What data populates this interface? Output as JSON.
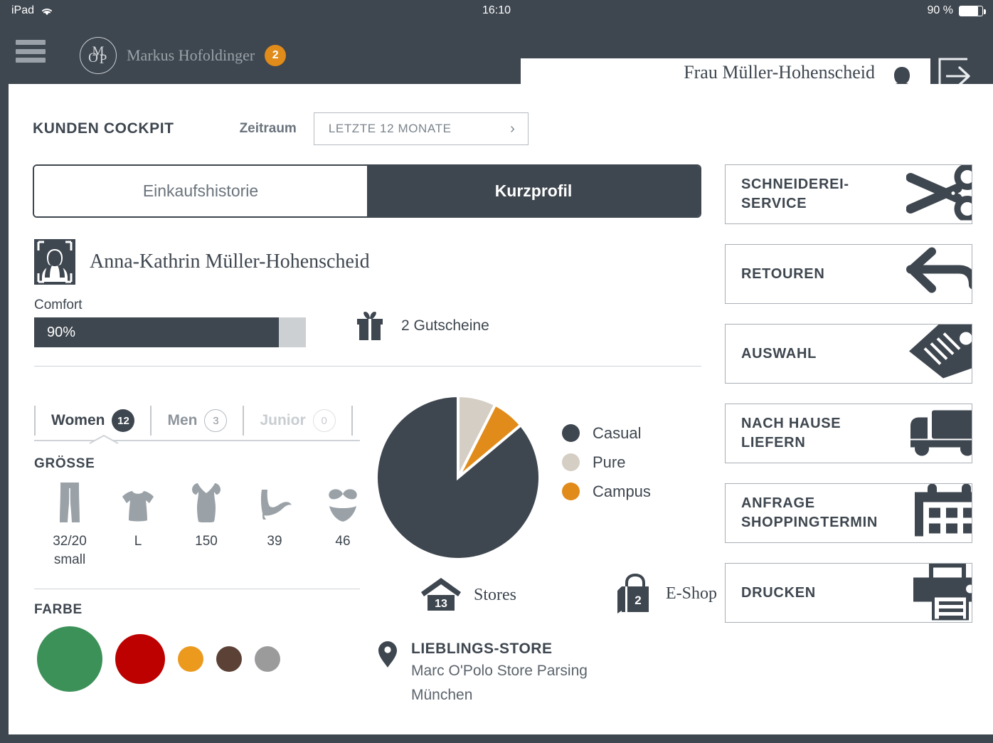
{
  "statusbar": {
    "device": "iPad",
    "wifi_icon": "wifi-icon",
    "time": "16:10",
    "battery_text": "90 %",
    "battery_level": 80
  },
  "header": {
    "menu_icon": "hamburger-menu-icon",
    "logo_icon": "marc-o-polo-logo-icon",
    "user_name": "Markus Hofoldinger",
    "notification_count": "2",
    "customer_name": "Frau Müller-Hohenscheid",
    "customer_status": "Comfort • 90%",
    "customer_avatar_icon": "female-avatar-check-icon",
    "logout_icon": "logout-arrow-icon"
  },
  "page": {
    "title": "KUNDEN COCKPIT",
    "period_label": "Zeitraum",
    "period_value": "LETZTE 12 MONATE",
    "period_chevron": "chevron-right-icon"
  },
  "tabs": [
    {
      "label": "Einkaufshistorie",
      "active": false
    },
    {
      "label": "Kurzprofil",
      "active": true
    }
  ],
  "profile": {
    "avatar_icon": "customer-portrait-icon",
    "name": "Anna-Kathrin Müller-Hohenscheid",
    "comfort_label": "Comfort",
    "comfort_value": "90%",
    "comfort_percent": 90,
    "voucher_icon": "gift-icon",
    "voucher_text": "2 Gutscheine"
  },
  "segments": [
    {
      "label": "Women",
      "count": "12",
      "state": "active"
    },
    {
      "label": "Men",
      "count": "3",
      "state": "mid"
    },
    {
      "label": "Junior",
      "count": "0",
      "state": "dim"
    }
  ],
  "sizes": {
    "title": "GRÖSSE",
    "items": [
      {
        "icon": "pants-icon",
        "value": "32/20\nsmall"
      },
      {
        "icon": "tshirt-icon",
        "value": "L"
      },
      {
        "icon": "dress-icon",
        "value": "150"
      },
      {
        "icon": "high-heel-shoe-icon",
        "value": "39"
      },
      {
        "icon": "bikini-icon",
        "value": "46"
      }
    ]
  },
  "colors": {
    "title": "FARBE",
    "items": [
      {
        "name": "green",
        "hex": "#3c9158",
        "size": 92
      },
      {
        "name": "dark-red",
        "hex": "#bd0000",
        "size": 70
      },
      {
        "name": "orange",
        "hex": "#eb9a1e",
        "size": 36
      },
      {
        "name": "brown",
        "hex": "#5b4136",
        "size": 36
      },
      {
        "name": "grey",
        "hex": "#9b9b9b",
        "size": 36
      }
    ]
  },
  "chart_data": {
    "type": "pie",
    "title": "",
    "legend_position": "right",
    "categories": [
      "Casual",
      "Pure",
      "Campus"
    ],
    "values": [
      86.1,
      7.5,
      6.4
    ],
    "colors": [
      "#3e464f",
      "#d5cec4",
      "#e08b1a"
    ],
    "labels": [
      "Casual",
      "Pure",
      "Campus"
    ]
  },
  "channels": [
    {
      "icon": "store-house-icon",
      "count": "13",
      "label": "Stores"
    },
    {
      "icon": "shopping-bag-icon",
      "count": "2",
      "label": "E-Shop"
    }
  ],
  "favorite_store": {
    "pin_icon": "map-pin-icon",
    "title": "LIEBLINGS-STORE",
    "line1": "Marc O'Polo Store Parsing",
    "line2": "München"
  },
  "actions": [
    {
      "label": "SCHNEIDEREI-\nSERVICE",
      "icon": "scissors-icon"
    },
    {
      "label": "RETOUREN",
      "icon": "return-arrow-icon"
    },
    {
      "label": "AUSWAHL",
      "icon": "price-tag-icon"
    },
    {
      "label": "NACH HAUSE\nLIEFERN",
      "icon": "delivery-truck-icon"
    },
    {
      "label": "ANFRAGE\nSHOPPINGTERMIN",
      "icon": "calendar-icon"
    },
    {
      "label": "DRUCKEN",
      "icon": "printer-icon"
    }
  ],
  "theme": {
    "dark": "#3e464f",
    "accent_orange": "#e08b1a",
    "muted": "#9aa1a8"
  }
}
